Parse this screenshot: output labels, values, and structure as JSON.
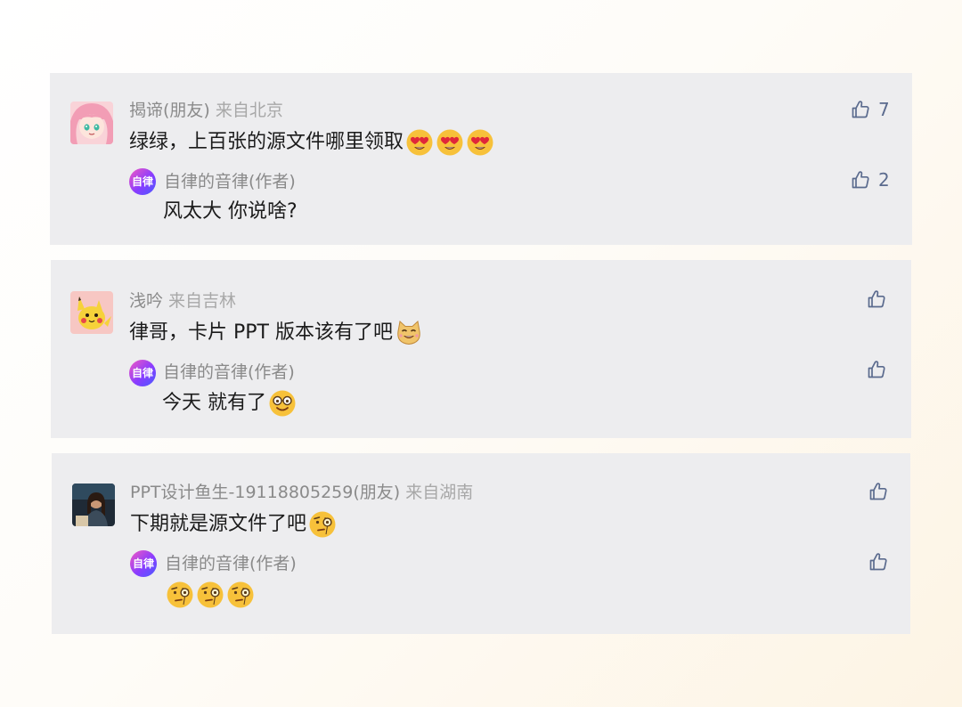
{
  "comments": [
    {
      "nickname": "揭谛(朋友)",
      "location": "来自北京",
      "text": "绿绿，上百张的源文件哪里领取",
      "emojis": [
        "heart-eyes-emoji",
        "heart-eyes-emoji",
        "heart-eyes-emoji"
      ],
      "likes": "7",
      "reply": {
        "author": "自律的音律(作者)",
        "avatar_text": "自律",
        "text": "风太大 你说啥?",
        "emojis": [],
        "likes": "2"
      }
    },
    {
      "nickname": "浅吟",
      "location": "来自吉林",
      "text": "律哥，卡片 PPT 版本该有了吧",
      "emojis": [
        "cat-face-emoji"
      ],
      "likes": "",
      "reply": {
        "author": "自律的音律(作者)",
        "avatar_text": "自律",
        "text": "今天 就有了",
        "emojis": [
          "grinning-glasses-emoji"
        ],
        "likes": ""
      }
    },
    {
      "nickname": "PPT设计鱼生-19118805259(朋友)",
      "location": "来自湖南",
      "text": "下期就是源文件了吧",
      "emojis": [
        "monocle-face-emoji"
      ],
      "likes": "",
      "reply": {
        "author": "自律的音律(作者)",
        "avatar_text": "自律",
        "text": "",
        "emojis": [
          "monocle-face-emoji",
          "monocle-face-emoji",
          "monocle-face-emoji"
        ],
        "likes": ""
      }
    }
  ],
  "colors": {
    "card_background": "#ededef",
    "nickname": "#8a8a8a",
    "location": "#a8a8a8",
    "comment_text": "#1b1b1b",
    "like_icon": "#5b6b8e",
    "emoji_yellow": "#f7c13a"
  }
}
